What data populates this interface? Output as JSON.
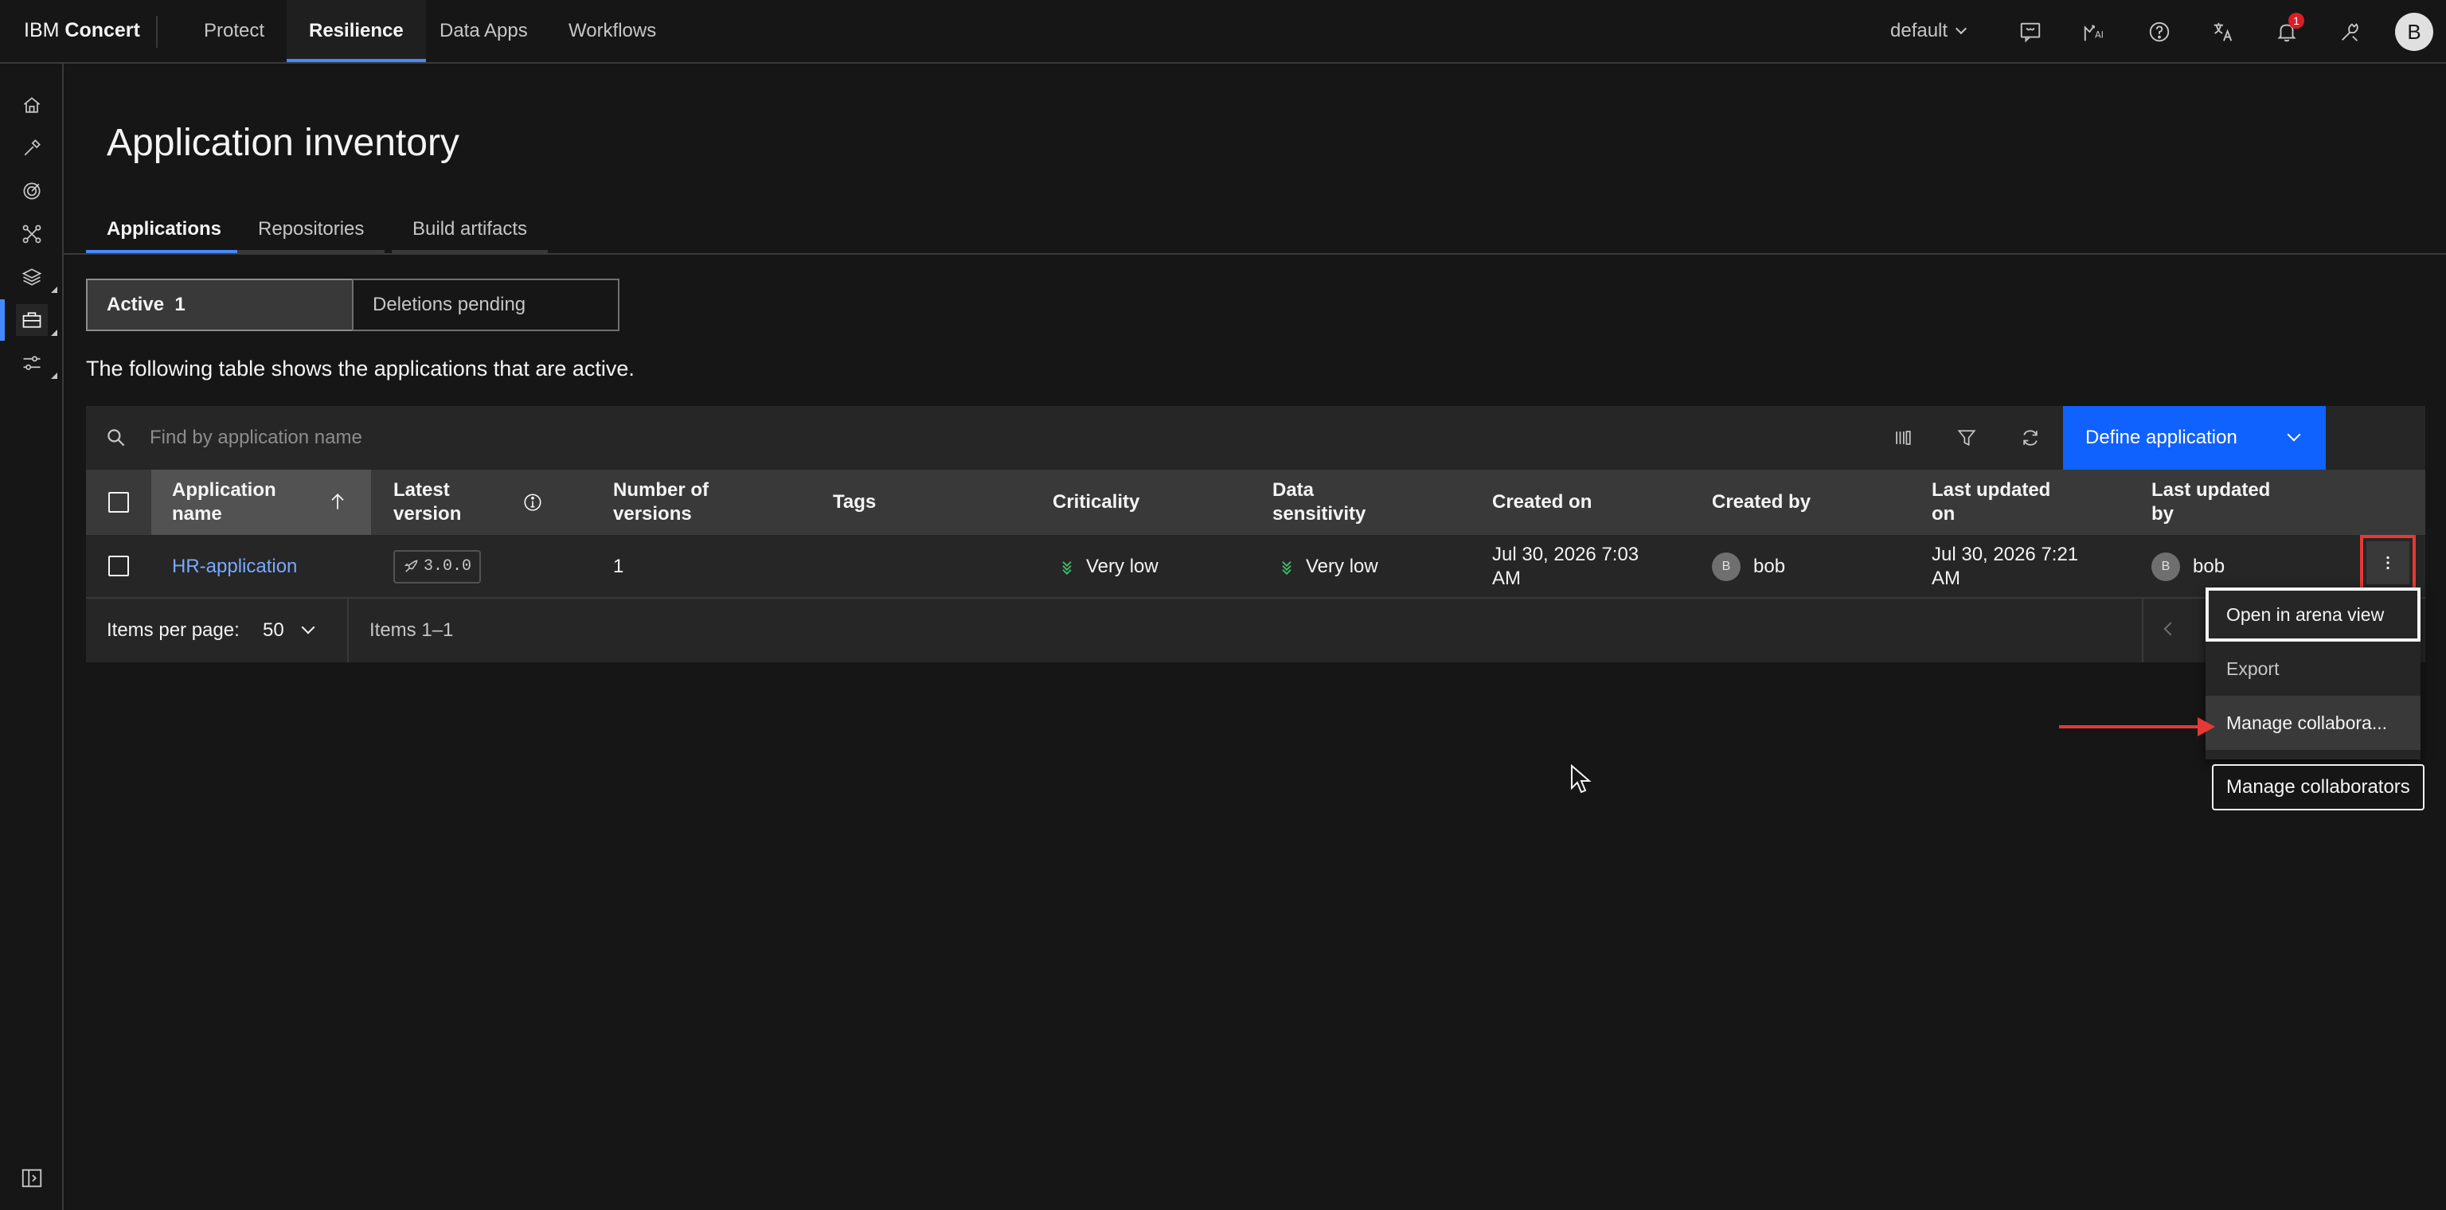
{
  "header": {
    "brand_prefix": "IBM",
    "brand_name": "Concert",
    "nav": [
      {
        "label": "Protect"
      },
      {
        "label": "Resilience"
      },
      {
        "label": "Data Apps"
      },
      {
        "label": "Workflows"
      }
    ],
    "workspace": "default",
    "notifications_count": "1",
    "user_initial": "B"
  },
  "page": {
    "title": "Application inventory",
    "tabs": [
      {
        "label": "Applications"
      },
      {
        "label": "Repositories"
      },
      {
        "label": "Build artifacts"
      }
    ],
    "segments": {
      "active_label": "Active",
      "active_count": "1",
      "pending_label": "Deletions pending"
    },
    "description": "The following table shows the applications that are active."
  },
  "toolbar": {
    "search_placeholder": "Find by application name",
    "define_label": "Define application"
  },
  "table": {
    "columns": [
      {
        "l1": "Application",
        "l2": "name"
      },
      {
        "l1": "Latest",
        "l2": "version"
      },
      {
        "l1": "Number of",
        "l2": "versions"
      },
      {
        "l1": "Tags",
        "l2": ""
      },
      {
        "l1": "Criticality",
        "l2": ""
      },
      {
        "l1": "Data",
        "l2": "sensitivity"
      },
      {
        "l1": "Created on",
        "l2": ""
      },
      {
        "l1": "Created by",
        "l2": ""
      },
      {
        "l1": "Last updated",
        "l2": "on"
      },
      {
        "l1": "Last updated",
        "l2": "by"
      }
    ],
    "rows": [
      {
        "name": "HR-application",
        "version": "3.0.0",
        "num_versions": "1",
        "tags": "",
        "criticality": "Very low",
        "sensitivity": "Very low",
        "created_on_1": "Jul 30, 2026 7:03",
        "created_on_2": "AM",
        "created_by_initial": "B",
        "created_by": "bob",
        "updated_on_1": "Jul 30, 2026 7:21",
        "updated_on_2": "AM",
        "updated_by_initial": "B",
        "updated_by": "bob"
      }
    ]
  },
  "pagination": {
    "items_per_page_label": "Items per page:",
    "items_per_page": "50",
    "range": "Items 1–1"
  },
  "overflow_menu": {
    "items": [
      {
        "label": "Open in arena view"
      },
      {
        "label": "Export"
      },
      {
        "label": "Manage collabora..."
      }
    ],
    "tooltip": "Manage collaborators"
  },
  "colors": {
    "accent": "#0f62fe",
    "link": "#78a9ff",
    "annotation": "#e53935",
    "low_severity": "#42be65"
  }
}
